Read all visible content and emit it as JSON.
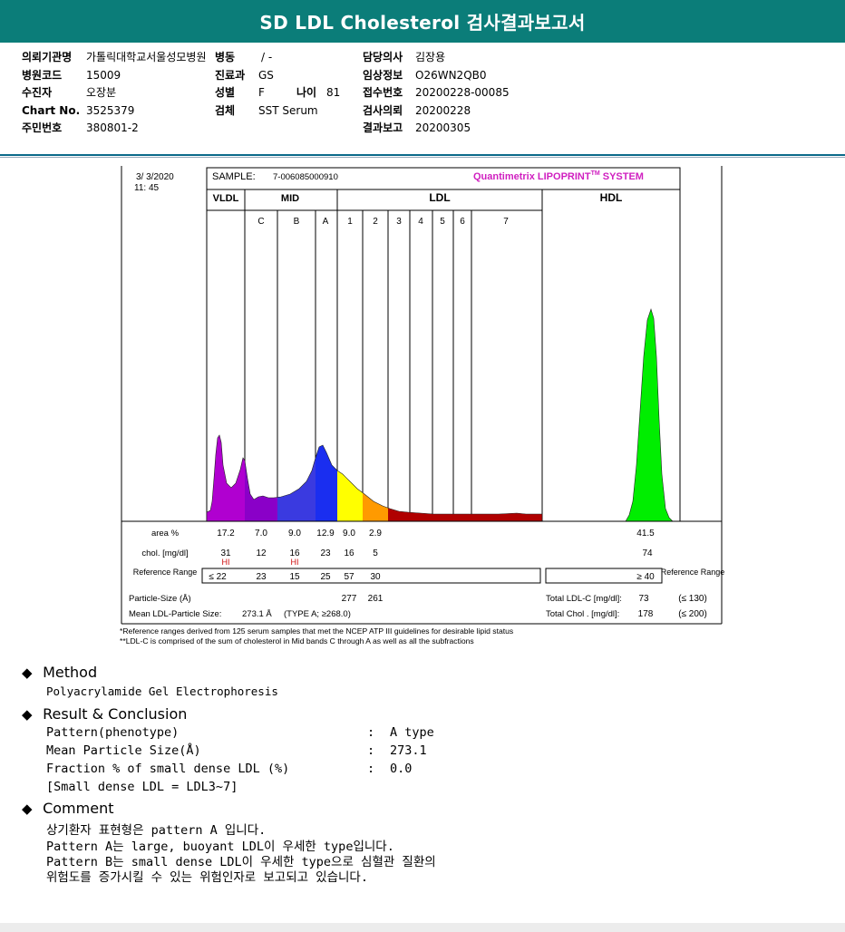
{
  "header": {
    "title": "SD LDL Cholesterol 검사결과보고서"
  },
  "patient": {
    "institution_label": "의뢰기관명",
    "institution": "가톨릭대학교서울성모병원",
    "ward_label": "병동",
    "ward": "/ -",
    "doctor_label": "담당의사",
    "doctor": "김장용",
    "hospital_code_label": "병원코드",
    "hospital_code": "15009",
    "dept_label": "진료과",
    "dept": "GS",
    "clinical_label": "임상정보",
    "clinical": "O26WN2QB0",
    "examinee_label": "수진자",
    "examinee": "오장분",
    "sex_label": "성별",
    "sex": "F",
    "age_label": "나이",
    "age": "81",
    "receipt_label": "접수번호",
    "receipt": "20200228-00085",
    "chart_label": "Chart No.",
    "chart": "3525379",
    "specimen_label": "검체",
    "specimen": "SST Serum",
    "request_label": "검사의뢰",
    "request": "20200228",
    "resident_label": "주민번호",
    "resident": "380801-2",
    "report_label": "결과보고",
    "report": "20200305"
  },
  "lipoprint": {
    "date": "3/  3/2020",
    "time": "11: 45",
    "sample_label": "SAMPLE:",
    "sample": "7-006085000910",
    "brand": "Quantimetrix LIPOPRINT",
    "brand_tm": "TM",
    "brand_suffix": " SYSTEM",
    "groups": {
      "vldl": "VLDL",
      "mid": "MID",
      "ldl": "LDL",
      "hdl": "HDL"
    },
    "bands": [
      "C",
      "B",
      "A",
      "1",
      "2",
      "3",
      "4",
      "5",
      "6",
      "7"
    ],
    "row_labels": {
      "area": "area %",
      "chol": "chol. [mg/dl]",
      "ref_range": "Reference Range",
      "ref_range_right": "Reference Range",
      "particle_size": "Particle-Size (Å)",
      "mean_size": "Mean LDL-Particle Size:"
    },
    "area": [
      "17.2",
      "7.0",
      "9.0",
      "12.9",
      "9.0",
      "2.9",
      "41.5"
    ],
    "chol": [
      "31",
      "12",
      "16",
      "23",
      "16",
      "5",
      "74"
    ],
    "hi_flags": [
      "HI",
      "HI"
    ],
    "ref": [
      "≤  22",
      "23",
      "15",
      "25",
      "57",
      "30"
    ],
    "ref_hdl": "≥ 40",
    "particle_size": [
      "277",
      "261"
    ],
    "mean_size_value": "273.1 Å",
    "mean_size_type": "(TYPE A; ≥268.0)",
    "total_ldl_label": "Total LDL-C [mg/dl]:",
    "total_ldl": "73",
    "total_ldl_ref": "(≤ 130)",
    "total_chol_label": "Total Chol . [mg/dl]:",
    "total_chol": "178",
    "total_chol_ref": "(≤ 200)",
    "footnote1": "*Reference ranges derived from 125 serum samples that met the NCEP ATP III guidelines for desirable lipid status",
    "footnote2": "**LDL-C is comprised of the sum of cholesterol in Mid bands C through A as well as all the subfractions"
  },
  "method": {
    "heading": "Method",
    "text": "Polyacrylamide Gel Electrophoresis"
  },
  "result": {
    "heading": "Result & Conclusion",
    "rows": [
      {
        "label": "Pattern(phenotype)",
        "sep": ":",
        "value": "A type"
      },
      {
        "label": "Mean Particle Size(Å)",
        "sep": ":",
        "value": "273.1"
      },
      {
        "label": "Fraction % of small dense LDL (%)",
        "sep": ":",
        "value": "0.0"
      }
    ],
    "note": "[Small dense LDL = LDL3~7]"
  },
  "comment": {
    "heading": "Comment",
    "lines": [
      "상기환자 표현형은 pattern A 입니다.",
      "Pattern A는 large, buoyant LDL이 우세한 type입니다.",
      "Pattern B는 small dense LDL이 우세한 type으로 심혈관 질환의",
      "위험도를 증가시킬 수 있는 위험인자로 보고되고 있습니다."
    ]
  },
  "chart_data": {
    "type": "area",
    "title": "",
    "xlabel": "",
    "ylabel": "",
    "categories": [
      "VLDL",
      "MID C",
      "MID B",
      "MID A",
      "LDL 1",
      "LDL 2",
      "LDL 3",
      "LDL 4",
      "LDL 5",
      "LDL 6",
      "LDL 7",
      "HDL"
    ],
    "series": [
      {
        "values": [
          17.2,
          7.0,
          9.0,
          12.9,
          9.0,
          2.9,
          0,
          0,
          0,
          0,
          0,
          41.5
        ]
      }
    ],
    "colors": {
      "vldl": "#b000d0",
      "midC": "#8a00c8",
      "midB": "#3a3ae0",
      "midA": "#1a2ef0",
      "ldl1": "#ffff00",
      "ldl2": "#ff9a00",
      "ldl3": "#b00000",
      "hdl": "#00ee00"
    }
  }
}
